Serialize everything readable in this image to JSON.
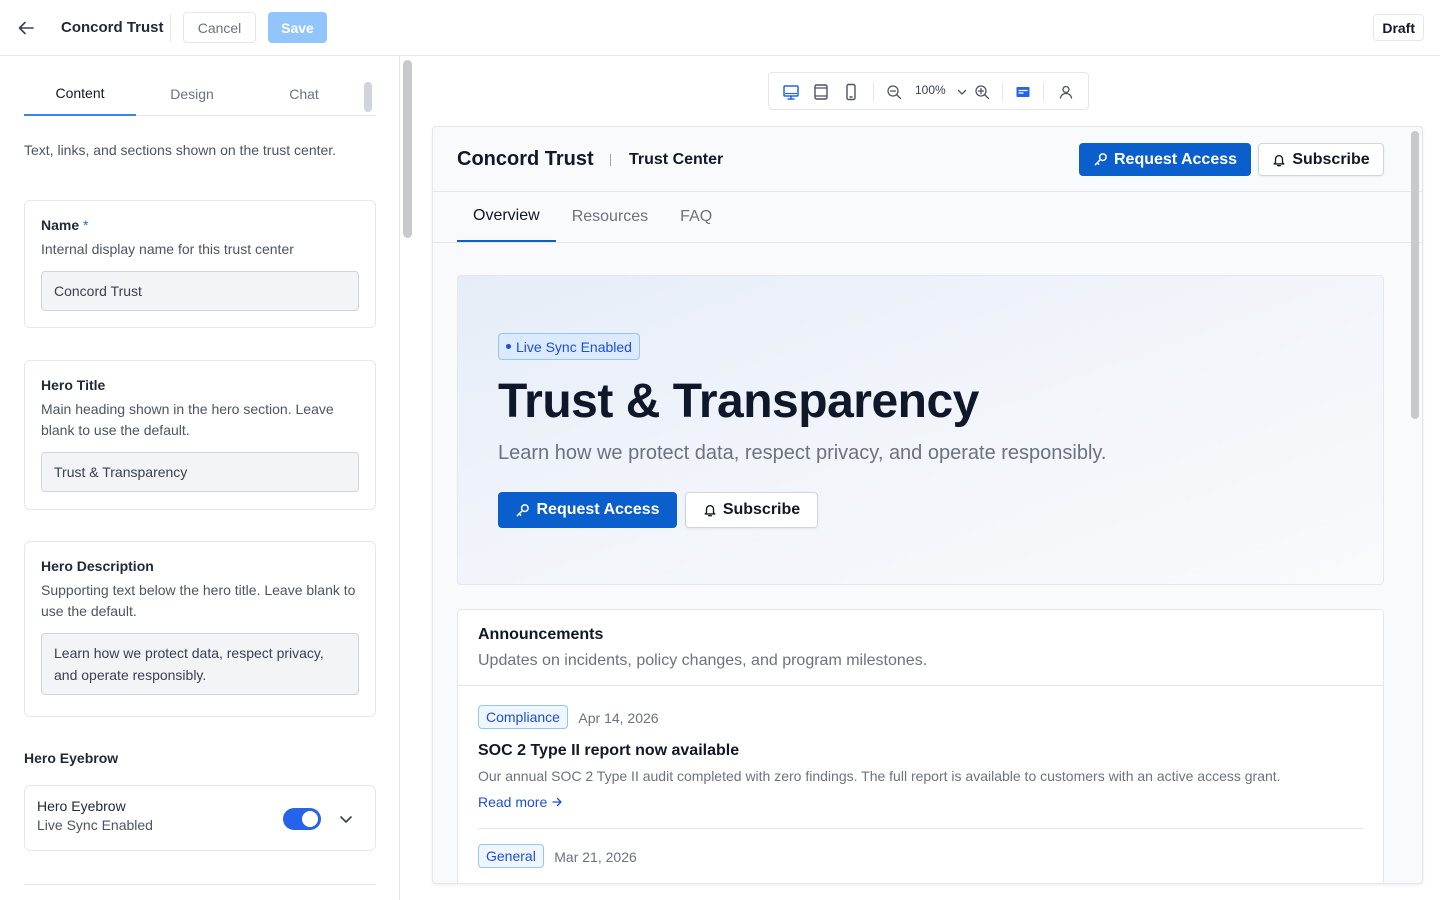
{
  "topbar": {
    "title": "Concord Trust",
    "cancel_label": "Cancel",
    "save_label": "Save",
    "status_badge": "Draft"
  },
  "left_panel": {
    "tabs": [
      {
        "label": "Content",
        "active": true
      },
      {
        "label": "Design",
        "active": false
      },
      {
        "label": "Chat",
        "active": false
      }
    ],
    "description": "Text, links, and sections shown on the trust center.",
    "fields": {
      "name": {
        "label": "Name",
        "required_mark": "*",
        "help": "Internal display name for this trust center",
        "value": "Concord Trust"
      },
      "hero_title": {
        "label": "Hero Title",
        "help": "Main heading shown in the hero section. Leave blank to use the default.",
        "value": "Trust & Transparency"
      },
      "hero_description": {
        "label": "Hero Description",
        "help": "Supporting text below the hero title. Leave blank to use the default.",
        "value": "Learn how we protect data, respect privacy, and operate responsibly."
      }
    },
    "eyebrow_section": {
      "heading": "Hero Eyebrow",
      "card_title": "Hero Eyebrow",
      "card_value": "Live Sync Enabled",
      "toggle_on": true
    }
  },
  "viewbar": {
    "zoom": "100%",
    "icons": [
      "desktop-icon",
      "tablet-icon",
      "mobile-icon",
      "zoom-out-icon",
      "zoom-in-icon",
      "layout-icon",
      "user-icon"
    ]
  },
  "preview": {
    "brand": "Concord Trust",
    "subtitle": "Trust Center",
    "request_access_label": "Request Access",
    "subscribe_label": "Subscribe",
    "tabs": [
      {
        "label": "Overview",
        "active": true
      },
      {
        "label": "Resources",
        "active": false
      },
      {
        "label": "FAQ",
        "active": false
      }
    ],
    "hero": {
      "eyebrow": "Live Sync Enabled",
      "title": "Trust & Transparency",
      "description": "Learn how we protect data, respect privacy, and operate responsibly.",
      "request_access_label": "Request Access",
      "subscribe_label": "Subscribe"
    },
    "announcements": {
      "title": "Announcements",
      "subtitle": "Updates on incidents, policy changes, and program milestones.",
      "items": [
        {
          "tag": "Compliance",
          "date": "Apr 14, 2026",
          "title": "SOC 2 Type II report now available",
          "body": "Our annual SOC 2 Type II audit completed with zero findings. The full report is available to customers with an active access grant.",
          "link": "Read more"
        },
        {
          "tag": "General",
          "date": "Mar 21, 2026"
        }
      ]
    }
  },
  "colors": {
    "primary": "#0b5fcc",
    "accent": "#3b82f6",
    "save_disabled": "#93c5fd",
    "toggle_on": "#2563eb"
  }
}
